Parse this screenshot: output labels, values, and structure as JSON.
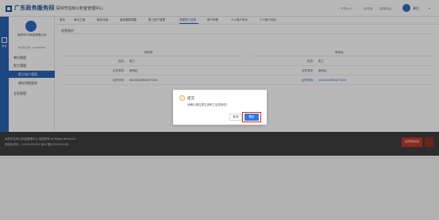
{
  "header": {
    "logo_text": "广东政务服务网",
    "system_title": "深圳市住房公积金管理中心",
    "links": [
      "~ 字体大小 ~",
      "| 老年版",
      "| 客服电话"
    ],
    "user_name": "单位",
    "user_caret": "▾"
  },
  "rail": {
    "label": "单位"
  },
  "sidebar": {
    "org_name": "深圳市XX科技有限公司",
    "org_code": "单位登记号：1234567890",
    "menu": [
      {
        "label": "单位管理",
        "caret": "›"
      },
      {
        "label": "职工管理",
        "caret": "›"
      },
      {
        "label": "职工账户管理",
        "caret": ""
      },
      {
        "label": "缴存明细管理",
        "caret": ""
      },
      {
        "label": "业务管理",
        "caret": "›"
      }
    ]
  },
  "tabs": [
    "首页",
    "单位汇缴",
    "缴存补缴",
    "缴存基数调整",
    "职工账户管理",
    "变更职工信息",
    "账户转移",
    "个人账户封存",
    "个人账户启封"
  ],
  "main": {
    "section_title": "信息核对",
    "left_header": "修改前",
    "right_header": "修改后",
    "rows": [
      {
        "label": "姓名:",
        "left": "张三",
        "right": "张三",
        "right_is_link": false
      },
      {
        "label": "证件类型:",
        "left": "身份证",
        "right": "身份证",
        "right_is_link": false
      },
      {
        "label": "证件号码:",
        "left": "441234199003071234",
        "right": "441234199003071234",
        "right_is_link": true
      }
    ]
  },
  "dialog": {
    "title": "提交",
    "icon": "!",
    "message": "请确认是否提交该职工信息修改？",
    "cancel_label": "取消",
    "ok_label": "确定"
  },
  "footer": {
    "lines": [
      "深圳市住房公积金管理中心  版权所有  All Rights Reserved.",
      "网站标识码：XXXXXXXXXX  粤ICP备XXXXXXXX号"
    ],
    "badge_text": "政府网站找错"
  }
}
